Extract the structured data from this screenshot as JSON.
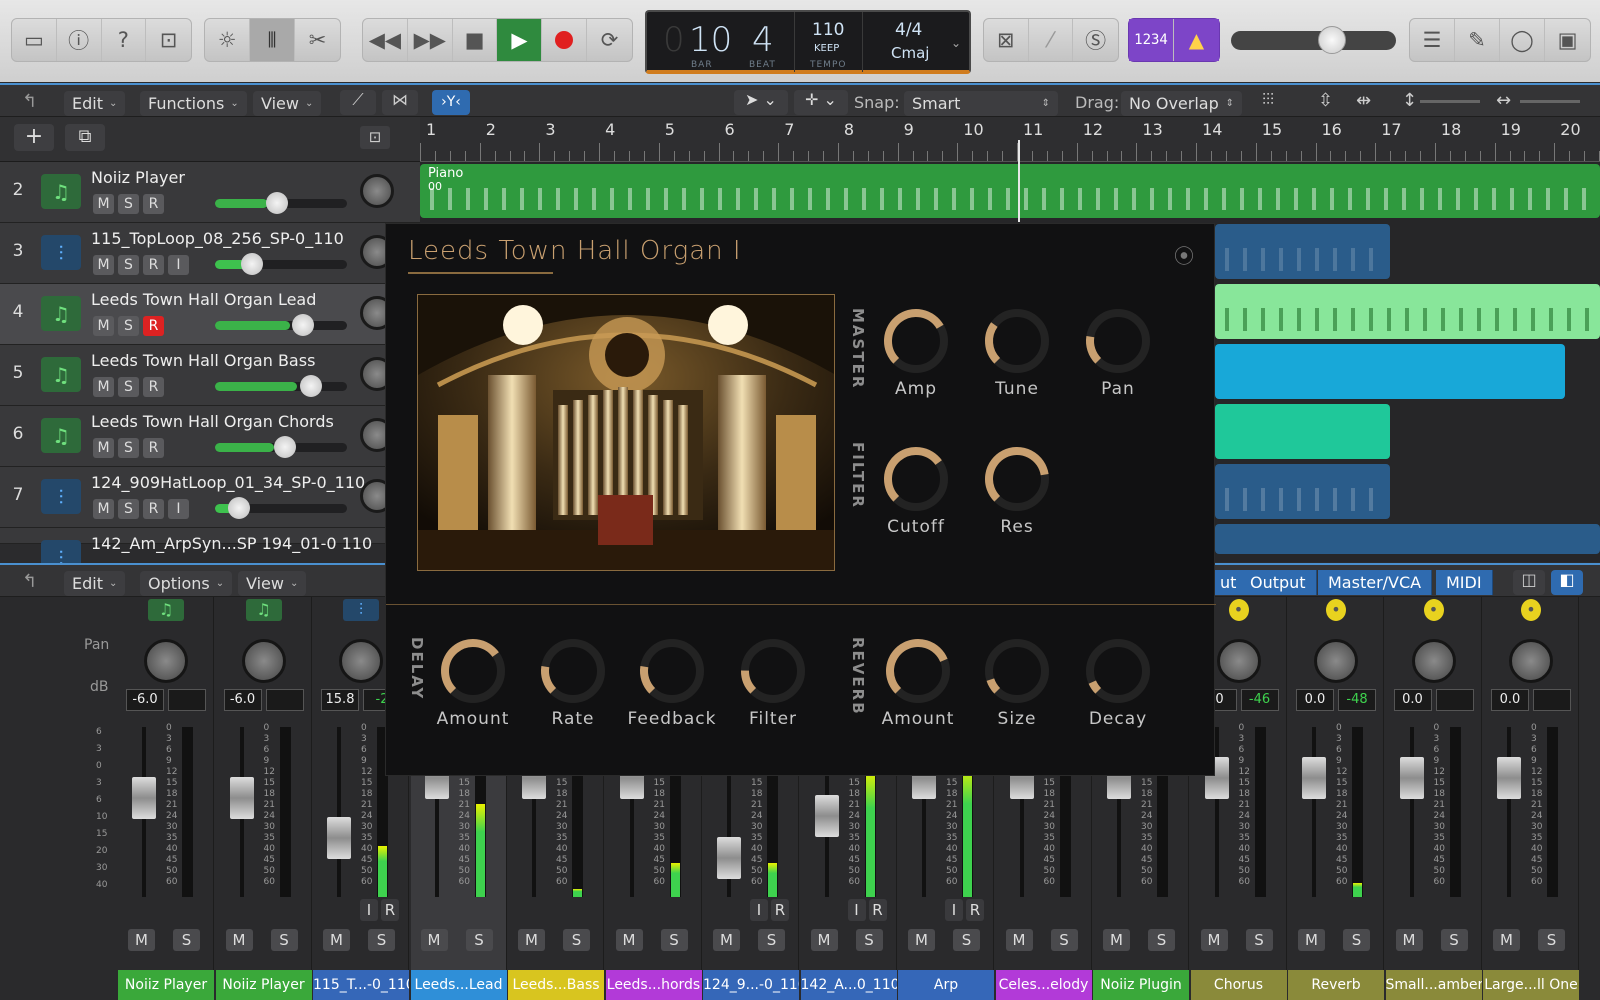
{
  "toolbar": {
    "left_icons": [
      "inbox-icon",
      "info-icon",
      "help-icon",
      "download-icon"
    ],
    "mid_icons": [
      "brightness-icon",
      "mixer-icon",
      "scissors-icon"
    ],
    "transport": [
      "rewind-icon",
      "fastforward-icon",
      "stop-icon",
      "play-icon",
      "record-icon",
      "cycle-icon"
    ],
    "right_icons": [
      "x-box-icon",
      "pencil-icon",
      "solo-box-icon"
    ],
    "count_in": "1234",
    "list_icons": [
      "list-icon",
      "note-icon",
      "loop-icon",
      "media-icon"
    ]
  },
  "lcd": {
    "bar": "10",
    "beat": "4",
    "bar_label": "BAR",
    "beat_label": "BEAT",
    "tempo": "110",
    "tempo_mode": "KEEP",
    "tempo_label": "TEMPO",
    "signature": "4/4",
    "key": "Cmaj"
  },
  "master_volume": 0.72,
  "tracks_bar": {
    "edit": "Edit",
    "functions": "Functions",
    "view": "View",
    "snap_label": "Snap:",
    "snap_value": "Smart",
    "drag_label": "Drag:",
    "drag_value": "No Overlap"
  },
  "ruler": [
    "1",
    "2",
    "3",
    "4",
    "5",
    "6",
    "7",
    "8",
    "9",
    "10",
    "11",
    "12",
    "13",
    "14",
    "15",
    "16",
    "17",
    "18",
    "19",
    "20"
  ],
  "tracks": [
    {
      "num": "2",
      "name": "Noiiz Player",
      "type": "midi",
      "buttons": [
        "M",
        "S",
        "R"
      ],
      "vol": 0.47,
      "selected": false,
      "rec": false
    },
    {
      "num": "3",
      "name": "115_TopLoop_08_256_SP-0_110",
      "type": "audio",
      "buttons": [
        "M",
        "S",
        "R",
        "I"
      ],
      "vol": 0.28,
      "selected": false,
      "rec": false
    },
    {
      "num": "4",
      "name": "Leeds Town Hall Organ Lead",
      "type": "midi",
      "buttons": [
        "M",
        "S",
        "R"
      ],
      "vol": 0.67,
      "selected": true,
      "rec": true
    },
    {
      "num": "5",
      "name": "Leeds Town Hall Organ Bass",
      "type": "midi",
      "buttons": [
        "M",
        "S",
        "R"
      ],
      "vol": 0.73,
      "selected": false,
      "rec": false
    },
    {
      "num": "6",
      "name": "Leeds Town Hall Organ Chords",
      "type": "midi",
      "buttons": [
        "M",
        "S",
        "R"
      ],
      "vol": 0.53,
      "selected": false,
      "rec": false
    },
    {
      "num": "7",
      "name": "124_909HatLoop_01_34_SP-0_110",
      "type": "audio",
      "buttons": [
        "M",
        "S",
        "R",
        "I"
      ],
      "vol": 0.18,
      "selected": false,
      "rec": false
    },
    {
      "num": "",
      "name": "142_Am_ArpSyn...SP 194_01-0 110",
      "type": "audio",
      "buttons": [],
      "vol": 0,
      "selected": false,
      "rec": false
    }
  ],
  "region_label": "Piano",
  "region_sublabel": "00",
  "mixer_bar": {
    "edit": "Edit",
    "options": "Options",
    "view": "View",
    "tabs": [
      "ut",
      "Output",
      "Master/VCA",
      "MIDI"
    ]
  },
  "mixer_labels": {
    "pan": "Pan",
    "db": "dB"
  },
  "meter_scale": [
    "6",
    "3",
    "0",
    "3",
    "6",
    "10",
    "15",
    "20",
    "30",
    "40"
  ],
  "strip_scale": [
    "0",
    "3",
    "6",
    "9",
    "12",
    "15",
    "18",
    "21",
    "24",
    "30",
    "35",
    "40",
    "45",
    "50",
    "60"
  ],
  "strips": [
    {
      "name": "Noiiz Player",
      "color": "#3aa83a",
      "db": "-6.0",
      "peak": "",
      "icon": "midi",
      "meter": 0
    },
    {
      "name": "Noiiz Player",
      "color": "#3aa83a",
      "db": "-6.0",
      "peak": "",
      "icon": "midi",
      "meter": 0
    },
    {
      "name": "115_T...-0_110",
      "color": "#3567b8",
      "db": "15.8",
      "peak": "-2",
      "icon": "audio",
      "meter": 0.3
    },
    {
      "name": "Leeds...Lead",
      "color": "#2f8fd8",
      "db": "",
      "peak": "",
      "icon": "",
      "meter": 0.55
    },
    {
      "name": "Leeds...Bass",
      "color": "#d8c51f",
      "db": "",
      "peak": "",
      "icon": "",
      "meter": 0.05
    },
    {
      "name": "Leeds...hords",
      "color": "#b23ad8",
      "db": "",
      "peak": "",
      "icon": "",
      "meter": 0.2
    },
    {
      "name": "124_9...-0_110",
      "color": "#3567b8",
      "db": "",
      "peak": "",
      "icon": "",
      "meter": 0.2
    },
    {
      "name": "142_A...0_110",
      "color": "#3567b8",
      "db": "",
      "peak": "",
      "icon": "",
      "meter": 0.75
    },
    {
      "name": "Arp",
      "color": "#3567b8",
      "db": "",
      "peak": "",
      "icon": "",
      "meter": 0.78
    },
    {
      "name": "Celes...elody",
      "color": "#b23ad8",
      "db": "",
      "peak": "",
      "icon": "",
      "meter": 0
    },
    {
      "name": "Noiiz Plugin",
      "color": "#3aa83a",
      "db": "",
      "peak": "",
      "icon": "",
      "meter": 0
    },
    {
      "name": "Chorus",
      "color": "#8a8a3a",
      "db": ".0",
      "peak": "-46",
      "icon": "yellow",
      "meter": 0
    },
    {
      "name": "Reverb",
      "color": "#8a8a3a",
      "db": "0.0",
      "peak": "-48",
      "icon": "yellow",
      "meter": 0.08
    },
    {
      "name": "Small...amber",
      "color": "#8a8a3a",
      "db": "0.0",
      "peak": "",
      "icon": "yellow",
      "meter": 0
    },
    {
      "name": "Large...ll One",
      "color": "#8a8a3a",
      "db": "0.0",
      "peak": "",
      "icon": "yellow",
      "meter": 0
    }
  ],
  "strip_buttons": {
    "m": "M",
    "s": "S",
    "i": "I",
    "r": "R"
  },
  "plugin": {
    "title": "Leeds Town Hall Organ I",
    "sections": {
      "master": "MASTER",
      "filter": "FILTER",
      "delay": "DELAY",
      "reverb": "REVERB"
    },
    "knobs": [
      {
        "label": "Amp",
        "value": 0.72
      },
      {
        "label": "Tune",
        "value": 0.3
      },
      {
        "label": "Pan",
        "value": 0.2
      },
      {
        "label": "Cutoff",
        "value": 0.7
      },
      {
        "label": "Res",
        "value": 0.8
      },
      {
        "label": "Amount",
        "value": 0.7
      },
      {
        "label": "Rate",
        "value": 0.2
      },
      {
        "label": "Feedback",
        "value": 0.2
      },
      {
        "label": "Filter",
        "value": 0.17
      },
      {
        "label": "Amount",
        "value": 0.75
      },
      {
        "label": "Size",
        "value": 0.1
      },
      {
        "label": "Decay",
        "value": 0.08
      }
    ],
    "accent": "#c9a070"
  }
}
